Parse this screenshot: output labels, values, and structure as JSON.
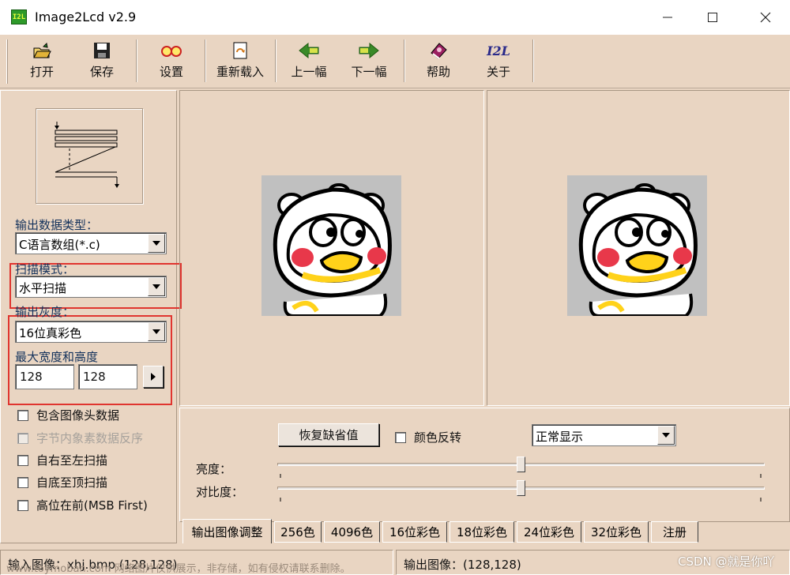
{
  "window": {
    "title": "Image2Lcd v2.9",
    "app_icon_text": "I2L"
  },
  "toolbar": {
    "open": "打开",
    "save": "保存",
    "settings": "设置",
    "reload": "重新载入",
    "prev": "上一幅",
    "next": "下一幅",
    "help": "帮助",
    "about": "关于",
    "about_icon_text": "I2L"
  },
  "left": {
    "output_type_label": "输出数据类型：",
    "output_type_value": "C语言数组(*.c)",
    "scan_mode_label": "扫描模式：",
    "scan_mode_value": "水平扫描",
    "gray_label": "输出灰度：",
    "gray_value": "16位真彩色",
    "maxsize_label": "最大宽度和高度",
    "max_width": "128",
    "max_height": "128",
    "checkboxes": [
      {
        "label": "包含图像头数据",
        "checked": false,
        "enabled": true
      },
      {
        "label": "字节内象素数据反序",
        "checked": false,
        "enabled": false
      },
      {
        "label": "自右至左扫描",
        "checked": false,
        "enabled": true
      },
      {
        "label": "自底至顶扫描",
        "checked": false,
        "enabled": true
      },
      {
        "label": "高位在前(MSB First)",
        "checked": false,
        "enabled": true
      }
    ]
  },
  "adjust": {
    "restore_button": "恢复缺省值",
    "invert_label": "颜色反转",
    "display_mode": "正常显示",
    "brightness_label": "亮度：",
    "contrast_label": "对比度：",
    "brightness_level": 0.5,
    "contrast_level": 0.5
  },
  "tabs": [
    "输出图像调整",
    "256色",
    "4096色",
    "16位彩色",
    "18位彩色",
    "24位彩色",
    "32位彩色",
    "注册"
  ],
  "status": {
    "input_image": "输入图像：xhj.bmp (128,128)",
    "output_image": "输出图像：(128,128)"
  },
  "overlay": {
    "watermark": "www.toymoban.com 网络图片仅供展示，非存储，如有侵权请联系删除。",
    "csdn": "CSDN @就是你吖"
  },
  "colors": {
    "window_bg": "#e9d5c2",
    "highlight": "#e0352f",
    "preview_bg": "#c0c0c0"
  }
}
